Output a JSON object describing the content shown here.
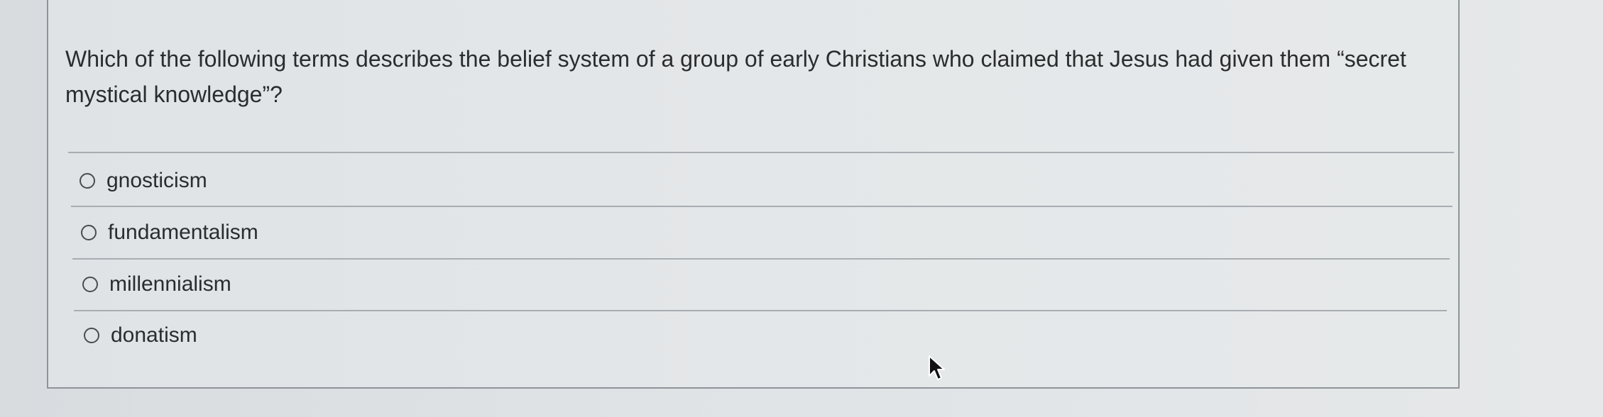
{
  "question": {
    "text": "Which of the following terms describes the belief system of a group of early Christians who claimed that Jesus had given them “secret mystical knowledge”?"
  },
  "options": [
    {
      "label": "gnosticism",
      "selected": false
    },
    {
      "label": "fundamentalism",
      "selected": false
    },
    {
      "label": "millennialism",
      "selected": false
    },
    {
      "label": "donatism",
      "selected": false
    }
  ],
  "colors": {
    "background": "#e1e4e6",
    "border": "#8f9499",
    "text": "#2a2c2e",
    "divider": "#a9adb1"
  },
  "icons": {
    "pointer": "mouse-pointer-icon",
    "radio": "radio-unchecked-icon"
  }
}
